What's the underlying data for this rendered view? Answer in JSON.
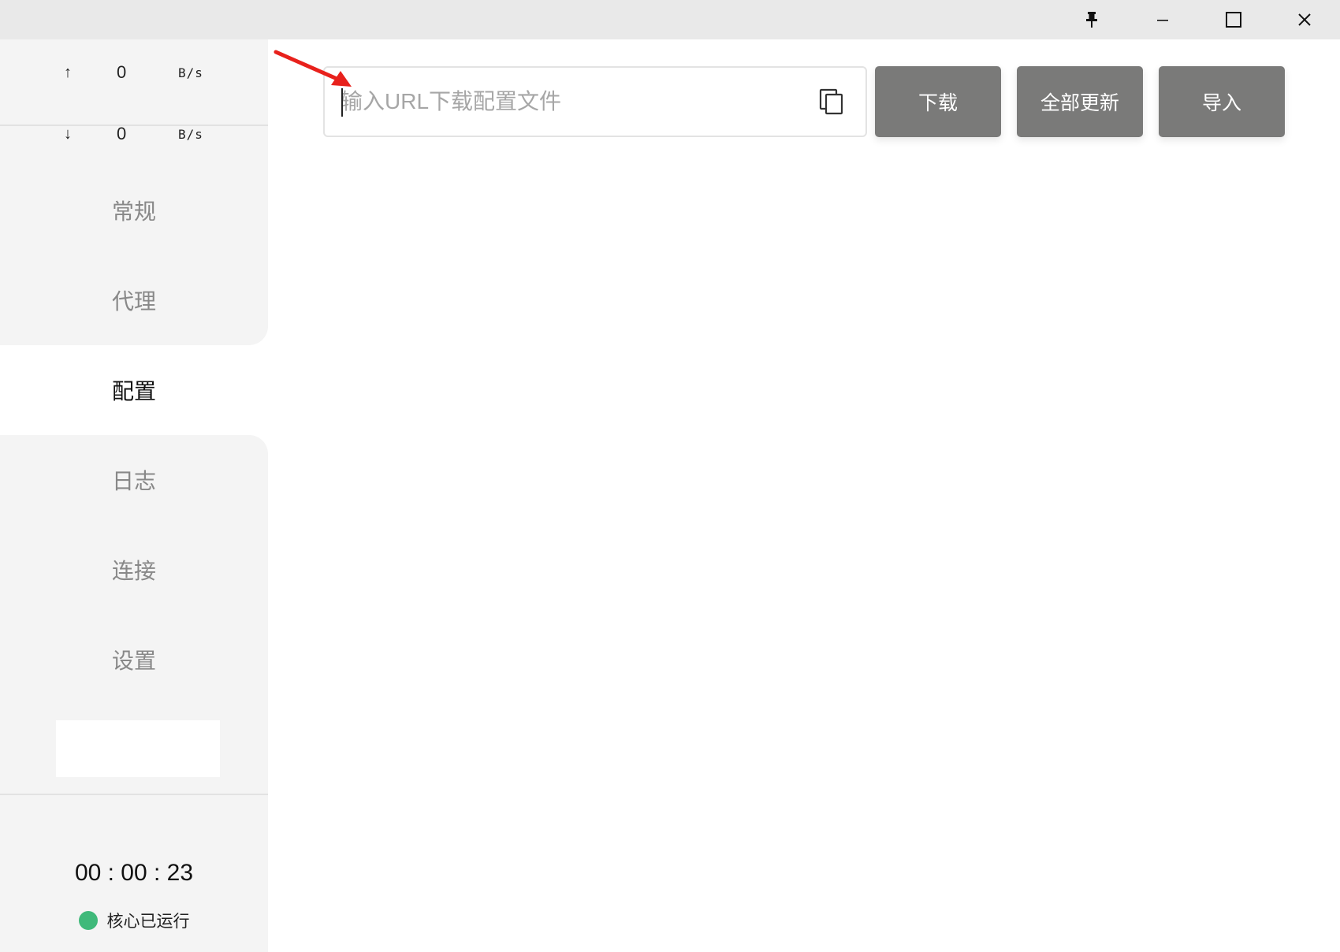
{
  "window": {
    "controls": [
      "pin-icon",
      "minimize-icon",
      "maximize-icon",
      "close-icon"
    ]
  },
  "traffic": {
    "upload": {
      "arrow": "↑",
      "value": "0",
      "unit": "B/s"
    },
    "download": {
      "arrow": "↓",
      "value": "0",
      "unit": "B/s"
    }
  },
  "sidebar": {
    "items": [
      {
        "label": "常规",
        "active": false
      },
      {
        "label": "代理",
        "active": false
      },
      {
        "label": "配置",
        "active": true
      },
      {
        "label": "日志",
        "active": false
      },
      {
        "label": "连接",
        "active": false
      },
      {
        "label": "设置",
        "active": false
      }
    ],
    "timer": "00 : 00 : 23",
    "status": "核心已运行",
    "status_color": "#3fb97a"
  },
  "toolbar": {
    "url_placeholder": "输入URL下载配置文件",
    "url_value": "",
    "paste_icon": "paste-icon",
    "download_label": "下载",
    "update_all_label": "全部更新",
    "import_label": "导入",
    "button_color": "#7a7a79"
  },
  "annotation": {
    "color": "#e8211c"
  }
}
